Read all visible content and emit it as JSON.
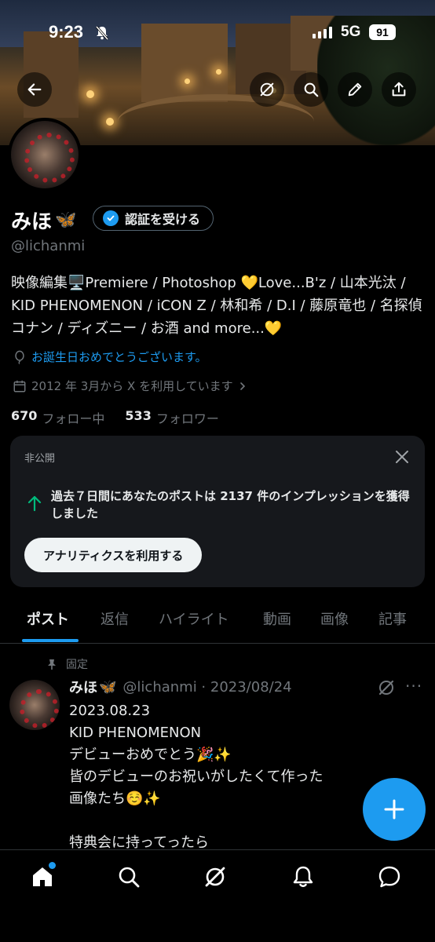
{
  "status_bar": {
    "time": "9:23",
    "network": "5G",
    "battery": "91"
  },
  "header": {
    "back_icon": "arrow-left-icon",
    "actions": [
      "grok-icon",
      "search-icon",
      "edit-icon",
      "share-icon"
    ]
  },
  "profile": {
    "display_name": "みほ",
    "name_emoji": "🦋",
    "verify_label": "認証を受ける",
    "handle": "@lichanmi",
    "bio": "映像編集🖥️Premiere / Photoshop 💛Love...B'z / 山本光汰 / KID PHENOMENON / iCON Z / 林和希 / D.I / 藤原竜也 / 名探偵コナン / ディズニー / お酒 and more...💛",
    "birthday_text": "お誕生日おめでとうございます。",
    "joined_text": "2012 年 3月から X を利用しています",
    "following_count": "670",
    "following_label": "フォロー中",
    "followers_count": "533",
    "followers_label": "フォロワー"
  },
  "private_card": {
    "tag": "非公開",
    "message": "過去７日間にあなたのポストは 2137 件のインプレッションを獲得しました",
    "button_label": "アナリティクスを利用する"
  },
  "tabs": [
    {
      "label": "ポスト",
      "active": true
    },
    {
      "label": "返信",
      "active": false
    },
    {
      "label": "ハイライト",
      "active": false
    },
    {
      "label": "動画",
      "active": false
    },
    {
      "label": "画像",
      "active": false
    },
    {
      "label": "記事",
      "active": false
    }
  ],
  "pinned_tweet": {
    "pinned_label": "固定",
    "name": "みほ",
    "name_emoji": "🦋",
    "meta": "@lichanmi · 2023/08/24",
    "more": "···",
    "body": "2023.08.23\nKID PHENOMENON\nデビューおめでとう🎉✨\n皆のデビューのお祝いがしたくて作った\n画像たち☺️✨\n\n特典会に持ってったら"
  },
  "bottom_nav": [
    "home-icon",
    "search-icon",
    "grok-icon",
    "notifications-icon",
    "messages-icon"
  ],
  "colors": {
    "accent": "#1d9bf0",
    "background": "#000000",
    "muted": "#71767b",
    "card": "#16181c"
  }
}
